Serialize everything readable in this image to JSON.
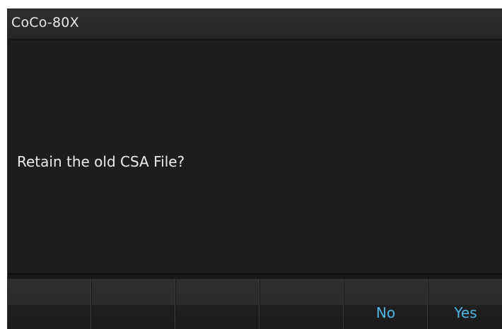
{
  "window": {
    "title": "CoCo-80X"
  },
  "dialog": {
    "message": "Retain the old CSA File?"
  },
  "softkeys": [
    {
      "label": ""
    },
    {
      "label": ""
    },
    {
      "label": ""
    },
    {
      "label": ""
    },
    {
      "label": "No"
    },
    {
      "label": "Yes"
    }
  ],
  "colors": {
    "background": "#1d1d1d",
    "text": "#ececec",
    "softkey_label": "#4fb6e6"
  }
}
